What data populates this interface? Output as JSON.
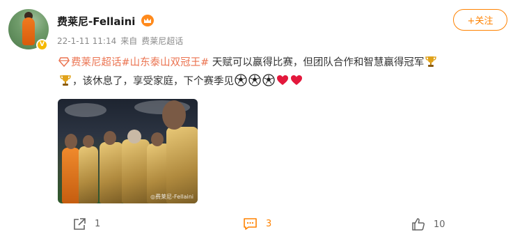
{
  "post": {
    "username": "费莱尼-Fellaini",
    "timestamp": "22-1-11 11:14",
    "source_prefix": "来自",
    "source": "费莱尼超话",
    "follow_label": "+关注",
    "content": {
      "tag1": "费莱尼超话",
      "tag2": "#山东泰山双冠王#",
      "text1": " 天赋可以赢得比赛，但团队合作和智慧赢得冠军",
      "text2": "，该休息了，享受家庭，下个赛季见"
    },
    "image_watermark": "◎费莱尼-Fellaini",
    "icons": {
      "verified": "verified-badge-icon",
      "member": "member-crown-icon",
      "topic": "supertopic-diamond-icon",
      "trophy": "trophy-emoji",
      "soccer": "soccer-ball-emoji",
      "heart": "red-heart-emoji"
    }
  },
  "actions": {
    "share_count": "1",
    "comment_count": "3",
    "like_count": "10"
  },
  "colors": {
    "accent": "#ff8200",
    "link": "#eb7350",
    "meta": "#8a8a8a"
  }
}
